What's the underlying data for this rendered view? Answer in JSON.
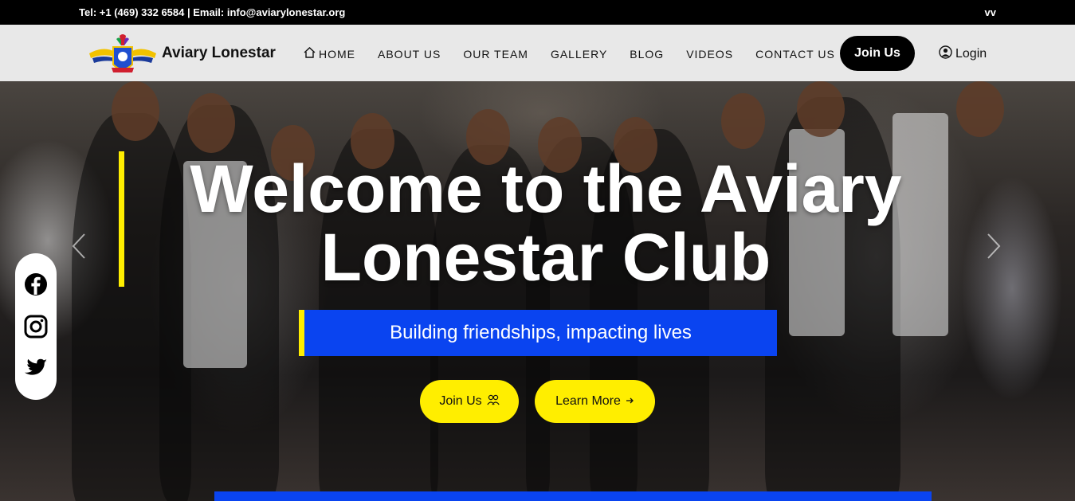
{
  "topbar": {
    "contact": "Tel: +1 (469) 332 6584 | Email: info@aviarylonestar.org",
    "right_text": "vv"
  },
  "header": {
    "brand": "Aviary Lonestar",
    "logo_icon": "club-crest-logo",
    "nav": [
      {
        "label": "HOME",
        "icon": "home-icon"
      },
      {
        "label": "ABOUT US"
      },
      {
        "label": "OUR TEAM"
      },
      {
        "label": "GALLERY"
      },
      {
        "label": "BLOG"
      },
      {
        "label": "VIDEOS"
      },
      {
        "label": "CONTACT US"
      }
    ],
    "join_label": "Join Us",
    "login_label": "Login",
    "login_icon": "user-circle-icon"
  },
  "hero": {
    "headline_line1": "Welcome to the Aviary",
    "headline_line2": "Lonestar Club",
    "tagline": "Building friendships, impacting lives",
    "cta_join": "Join Us",
    "cta_join_icon": "people-icon",
    "cta_learn": "Learn More",
    "cta_learn_icon": "arrow-right-icon",
    "prev_icon": "chevron-left-icon",
    "next_icon": "chevron-right-icon"
  },
  "social": [
    {
      "name": "facebook-icon"
    },
    {
      "name": "instagram-icon"
    },
    {
      "name": "twitter-icon"
    }
  ],
  "colors": {
    "accent_yellow": "#ffee00",
    "accent_blue": "#0a44f0",
    "topbar": "#000000",
    "navbar": "#e8e8e8"
  }
}
